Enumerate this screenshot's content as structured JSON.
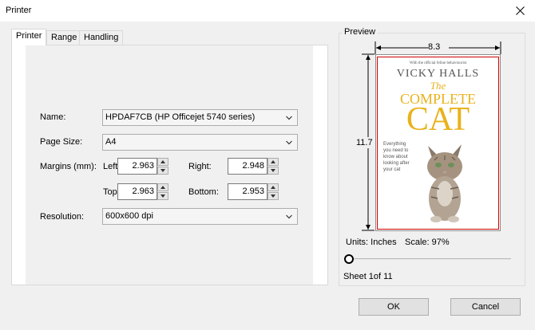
{
  "window": {
    "title": "Printer"
  },
  "tabs": [
    {
      "label": "Printer",
      "active": true
    },
    {
      "label": "Range",
      "active": false
    },
    {
      "label": "Handling",
      "active": false
    }
  ],
  "form": {
    "name_label": "Name:",
    "name_value": "HPDAF7CB (HP Officejet 5740 series)",
    "page_size_label": "Page Size:",
    "page_size_value": "A4",
    "margins_label": "Margins (mm):",
    "left_label": "Left:",
    "left_value": "2.963",
    "right_label": "Right:",
    "right_value": "2.948",
    "top_label": "Top:",
    "top_value": "2.963",
    "bottom_label": "Bottom:",
    "bottom_value": "2.953",
    "resolution_label": "Resolution:",
    "resolution_value": "600x600 dpi"
  },
  "preview": {
    "group_label": "Preview",
    "width_value": "8.3",
    "height_value": "11.7",
    "units_text": "Units: Inches",
    "scale_text": "Scale: 97%",
    "sheet_text": "Sheet 1of 11",
    "cover": {
      "tagline": "With the official feline behaviourist",
      "author": "VICKY HALLS",
      "title_the": "The",
      "title_complete": "COMPLETE",
      "title_cat": "CAT",
      "blurb": "Everything you need to know about looking after your cat"
    }
  },
  "buttons": {
    "ok": "OK",
    "cancel": "Cancel"
  },
  "colors": {
    "margin_line": "#d00000",
    "cover_title": "#e8b21b"
  }
}
